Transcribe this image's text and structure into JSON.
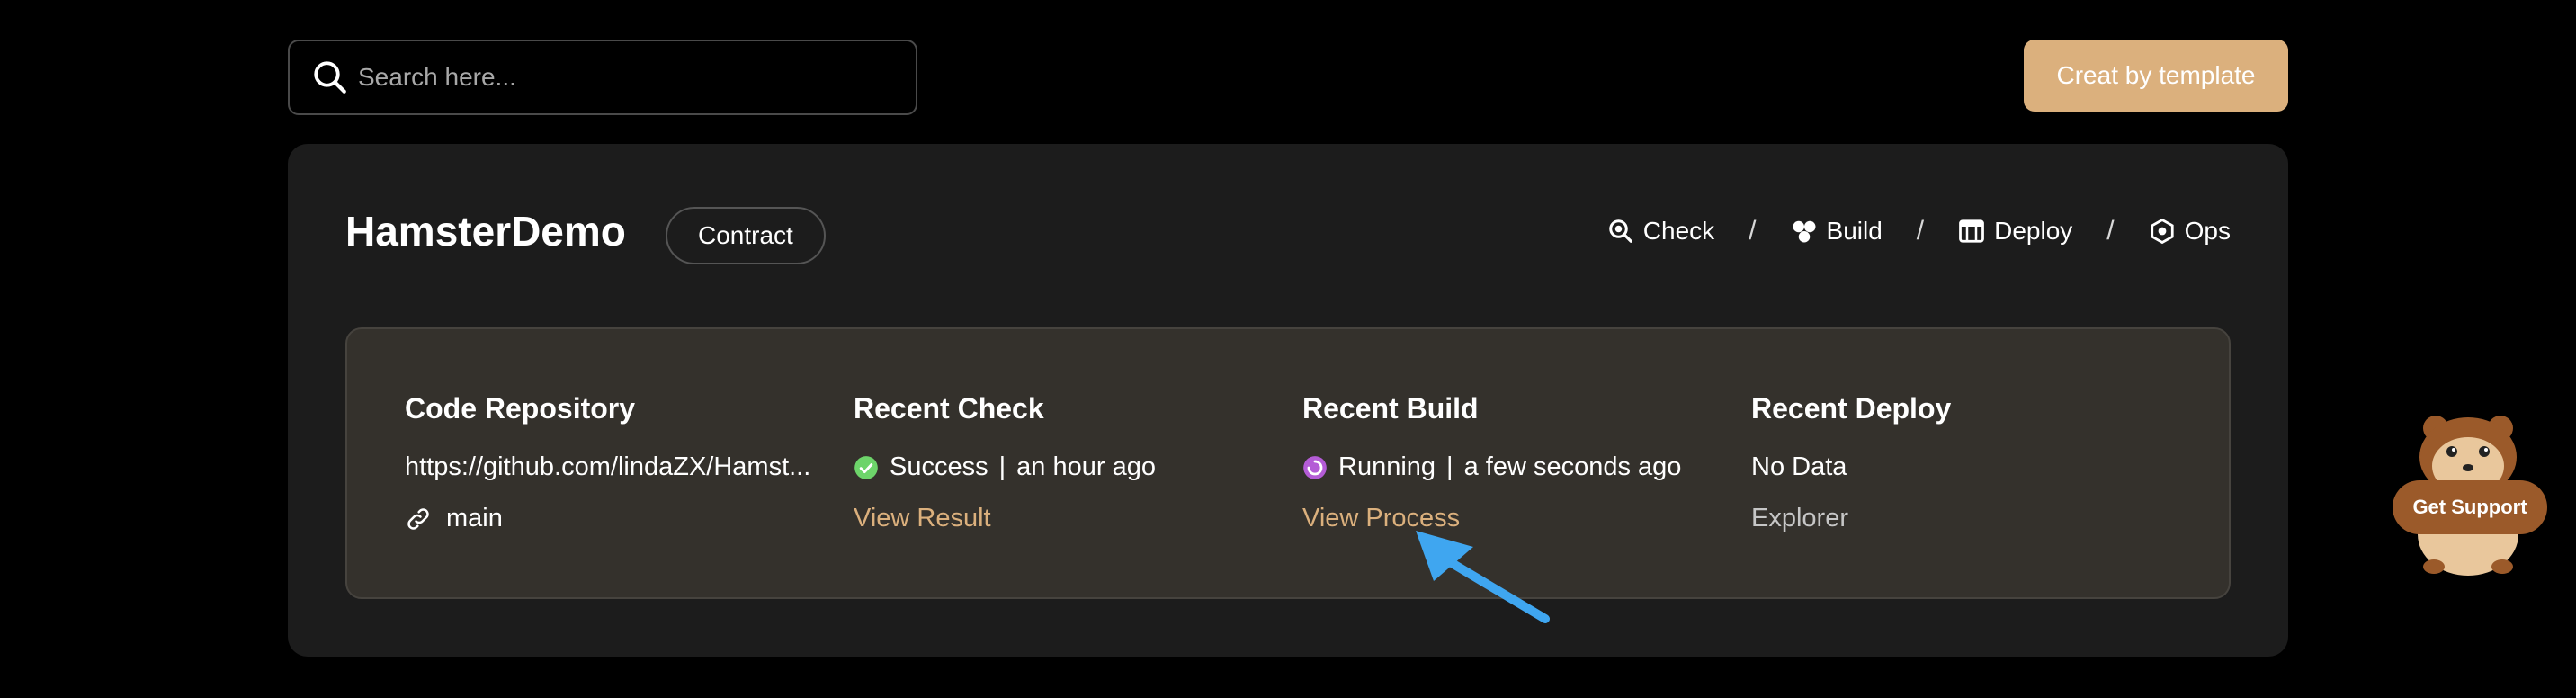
{
  "search": {
    "placeholder": "Search here...",
    "value": ""
  },
  "header": {
    "template_button": "Creat by template"
  },
  "project": {
    "name": "HamsterDemo",
    "type_tag": "Contract",
    "steps": [
      {
        "label": "Check",
        "icon": "magnifier-check-icon"
      },
      {
        "label": "Build",
        "icon": "cubes-icon"
      },
      {
        "label": "Deploy",
        "icon": "server-icon"
      },
      {
        "label": "Ops",
        "icon": "shield-gear-icon"
      }
    ],
    "step_separator": "/"
  },
  "panel": {
    "repo": {
      "title": "Code Repository",
      "url": "https://github.com/lindaZX/Hamst...",
      "branch": "main"
    },
    "check": {
      "title": "Recent Check",
      "status": "Success",
      "time": "an hour ago",
      "divider": "|",
      "link": "View Result",
      "status_color": "#6dd46a"
    },
    "build": {
      "title": "Recent Build",
      "status": "Running",
      "time": "a few seconds ago",
      "divider": "|",
      "link": "View Process",
      "status_color": "#b45cd6"
    },
    "deploy": {
      "title": "Recent Deploy",
      "status": "No Data",
      "link": "Explorer"
    }
  },
  "support": {
    "label": "Get Support"
  },
  "colors": {
    "accent": "#dbb07d",
    "card": "#1c1c1c",
    "panel": "#34312c",
    "arrow": "#3fa6f0"
  }
}
